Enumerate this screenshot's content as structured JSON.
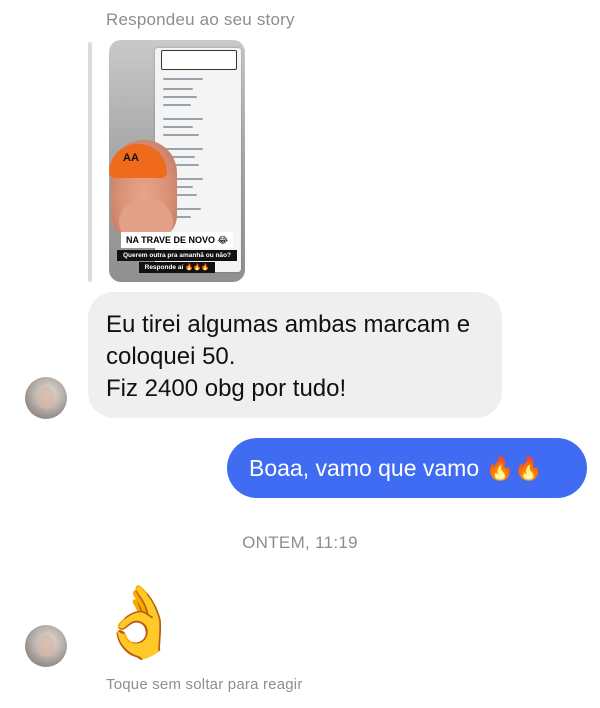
{
  "thread": {
    "reply_label": "Respondeu ao seu story",
    "story": {
      "banner": "NA TRAVE DE NOVO 😂",
      "question": "Querem outra pra amanhã ou não?",
      "prompt": "Responde aí 🔥🔥🔥",
      "cap_logo": "AA"
    },
    "incoming_message": {
      "lines": [
        "Eu tirei algumas ambas marcam e",
        "coloquei 50.",
        "Fiz 2400 obg por tudo!"
      ]
    },
    "outgoing_message": {
      "text": "Boaa, vamo que vamo 🔥🔥"
    },
    "timestamp": "ONTEM, 11:19",
    "reaction_emoji": "👌",
    "hint": "Toque sem soltar para reagir"
  },
  "colors": {
    "outgoing_bubble": "#3f6cf3",
    "incoming_bubble": "#efefef",
    "meta_text": "#8e8e8e"
  },
  "icons": [
    "avatar",
    "ok-hand-emoji",
    "fire-emoji"
  ]
}
